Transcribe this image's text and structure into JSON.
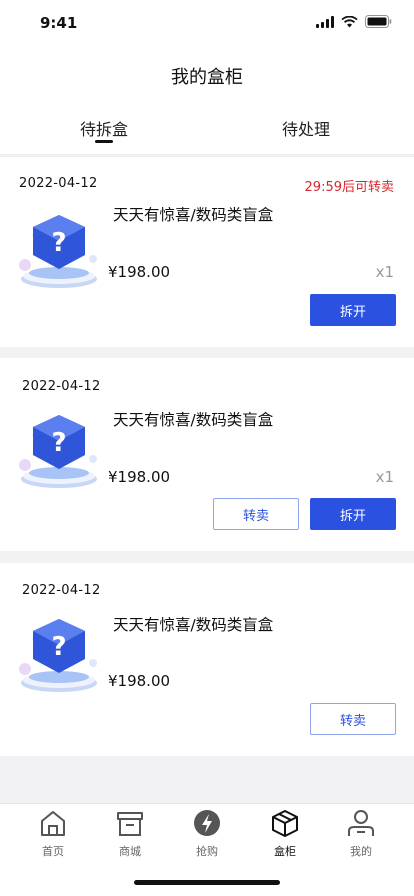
{
  "status_bar": {
    "time": "9:41"
  },
  "header": {
    "title": "我的盒柜",
    "tabs": [
      {
        "label": "待拆盒",
        "active": true
      },
      {
        "label": "待处理",
        "active": false
      }
    ]
  },
  "orders": [
    {
      "date": "2022-04-12",
      "timer": "29:59后可转卖",
      "name": "天天有惊喜/数码类盲盒",
      "price": "¥198.00",
      "qty": "x1",
      "buttons": [
        "拆开"
      ]
    },
    {
      "date": "2022-04-12",
      "name": "天天有惊喜/数码类盲盒",
      "price": "¥198.00",
      "qty": "x1",
      "buttons": [
        "转卖",
        "拆开"
      ]
    },
    {
      "date": "2022-04-12",
      "name": "天天有惊喜/数码类盲盒",
      "price": "¥198.00",
      "buttons": [
        "转卖"
      ]
    }
  ],
  "tabbar": [
    {
      "label": "首页",
      "icon": "home-icon"
    },
    {
      "label": "商城",
      "icon": "shop-icon"
    },
    {
      "label": "抢购",
      "icon": "lightning-icon"
    },
    {
      "label": "盒柜",
      "icon": "box-icon",
      "active": true
    },
    {
      "label": "我的",
      "icon": "user-icon"
    }
  ],
  "colors": {
    "accent": "#2a51e0",
    "timer": "#d9262b",
    "background": "#f2f2f4"
  }
}
